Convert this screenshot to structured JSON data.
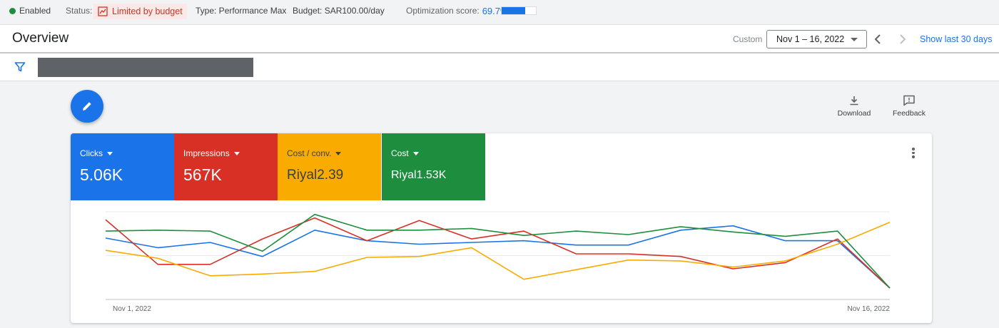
{
  "status_bar": {
    "enabled": "Enabled",
    "status_label": "Status:",
    "status_value": "Limited by budget",
    "type": "Type: Performance Max",
    "budget": "Budget: SAR100.00/day",
    "optimization_label": "Optimization score:",
    "optimization_value": "69.7%",
    "optimization_fraction": 0.697
  },
  "header": {
    "title": "Overview",
    "custom_label": "Custom",
    "date_range": "Nov 1 – 16, 2022",
    "show_last": "Show last 30 days"
  },
  "toolbar": {
    "download": "Download",
    "feedback": "Feedback"
  },
  "metrics": [
    {
      "label": "Clicks",
      "value": "5.06K",
      "color": "#1a73e8"
    },
    {
      "label": "Impressions",
      "value": "567K",
      "color": "#d93025"
    },
    {
      "label": "Cost / conv.",
      "value": "Riyal2.39",
      "color": "#f9ab00"
    },
    {
      "label": "Cost",
      "value": "Riyal1.53K",
      "color": "#1e8e3e"
    }
  ],
  "colors": {
    "clicks": "#1a73e8",
    "impressions": "#d93025",
    "cost_per_conv": "#f9ab00",
    "cost": "#1e8e3e",
    "accent": "#1a73e8"
  },
  "icons": [
    "budget-chart-icon",
    "filter-icon",
    "pencil-icon",
    "download-icon",
    "feedback-icon",
    "chevron-left-icon",
    "chevron-right-icon",
    "more-vert-icon"
  ],
  "chart_data": {
    "type": "line",
    "x": [
      "Nov 1, 2022",
      "Nov 2",
      "Nov 3",
      "Nov 4",
      "Nov 5",
      "Nov 6",
      "Nov 7",
      "Nov 8",
      "Nov 9",
      "Nov 10",
      "Nov 11",
      "Nov 12",
      "Nov 13",
      "Nov 14",
      "Nov 15",
      "Nov 16, 2022"
    ],
    "x_tick_labels": [
      "Nov 1, 2022",
      "Nov 16, 2022"
    ],
    "ylim": [
      0,
      100
    ],
    "grid": true,
    "series": [
      {
        "name": "Clicks",
        "color": "#1a73e8",
        "values": [
          70,
          59,
          65,
          49,
          79,
          67,
          63,
          65,
          67,
          62,
          62,
          79,
          84,
          67,
          67,
          13
        ]
      },
      {
        "name": "Impressions",
        "color": "#d93025",
        "values": [
          91,
          40,
          40,
          69,
          93,
          67,
          90,
          69,
          78,
          52,
          52,
          49,
          35,
          42,
          69,
          13
        ]
      },
      {
        "name": "Cost / conv.",
        "color": "#f9ab00",
        "values": [
          56,
          47,
          27,
          29,
          32,
          48,
          49,
          59,
          23,
          34,
          45,
          44,
          37,
          44,
          63,
          88
        ]
      },
      {
        "name": "Cost",
        "color": "#1e8e3e",
        "values": [
          78,
          79,
          78,
          55,
          97,
          79,
          79,
          81,
          73,
          78,
          74,
          83,
          77,
          72,
          78,
          13
        ]
      }
    ]
  }
}
